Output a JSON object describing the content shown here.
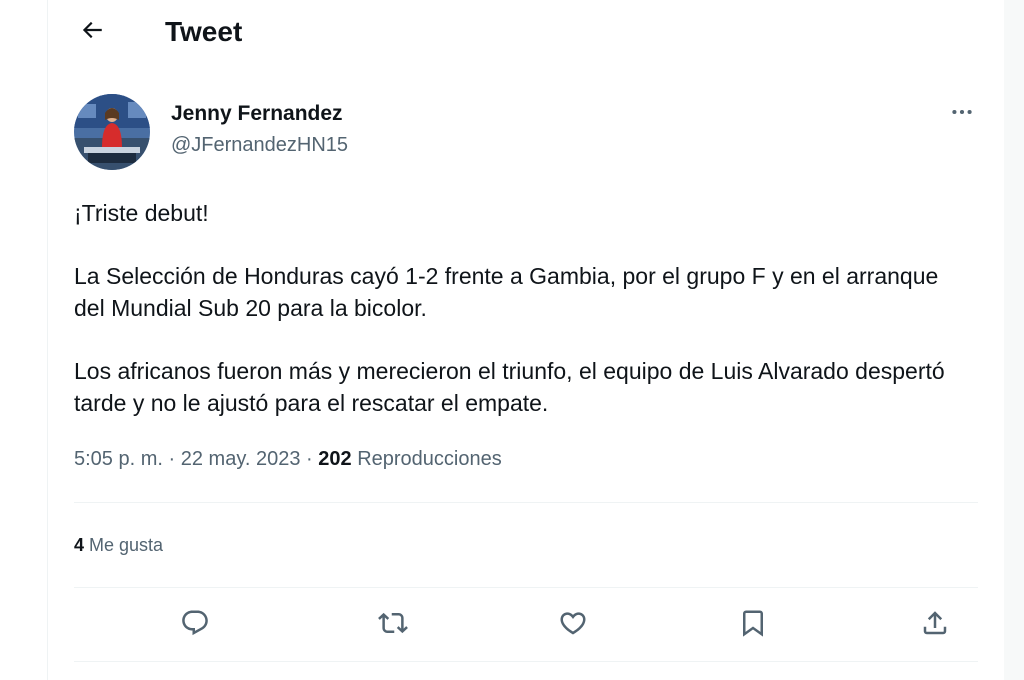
{
  "header": {
    "title": "Tweet",
    "back_icon": "arrow-left-icon"
  },
  "tweet": {
    "author": {
      "name": "Jenny Fernandez",
      "handle": "@JFernandezHN15"
    },
    "paragraphs": [
      "¡Triste debut!",
      "La Selección de Honduras cayó 1-2 frente a Gambia, por el grupo F y en el arranque del Mundial Sub 20 para la bicolor.",
      "Los africanos fueron más y merecieron el triunfo, el equipo de Luis Alvarado despertó tarde y no le ajustó para el rescatar el empate."
    ],
    "time": "5:05 p. m.",
    "separator": "·",
    "date": "22 may. 2023",
    "views_count": "202",
    "views_label": "Reproducciones",
    "likes_count": "4",
    "likes_label": "Me gusta"
  },
  "actions": [
    {
      "name": "reply",
      "icon": "reply-icon"
    },
    {
      "name": "retweet",
      "icon": "retweet-icon"
    },
    {
      "name": "like",
      "icon": "heart-icon"
    },
    {
      "name": "bookmark",
      "icon": "bookmark-icon"
    },
    {
      "name": "share",
      "icon": "share-icon"
    }
  ],
  "colors": {
    "text_primary": "#0f1419",
    "text_secondary": "#536471",
    "border": "#eff3f4",
    "background": "#ffffff"
  }
}
